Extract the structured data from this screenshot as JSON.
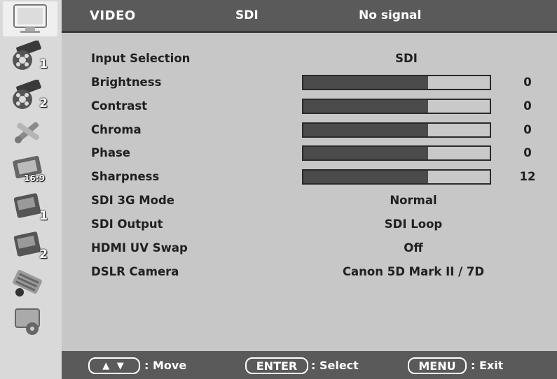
{
  "header": {
    "menu": "VIDEO",
    "source": "SDI",
    "signal": "No signal"
  },
  "sidebar": {
    "items": [
      {
        "icon": "monitor-icon",
        "badge": ""
      },
      {
        "icon": "film-reel-icon",
        "badge": "1"
      },
      {
        "icon": "film-reel-icon",
        "badge": "2"
      },
      {
        "icon": "tools-icon",
        "badge": ""
      },
      {
        "icon": "aspect-ratio-icon",
        "badge": "16:9"
      },
      {
        "icon": "abc-card-icon",
        "badge": "1"
      },
      {
        "icon": "abc-card-icon",
        "badge": "2"
      },
      {
        "icon": "keyboard-icon",
        "badge": ""
      },
      {
        "icon": "settings-screen-icon",
        "badge": ""
      }
    ]
  },
  "menu": {
    "input_selection": {
      "label": "Input Selection",
      "value": "SDI"
    },
    "brightness": {
      "label": "Brightness",
      "value": "0",
      "level": 0.67
    },
    "contrast": {
      "label": "Contrast",
      "value": "0",
      "level": 0.67
    },
    "chroma": {
      "label": "Chroma",
      "value": "0",
      "level": 0.67
    },
    "phase": {
      "label": "Phase",
      "value": "0",
      "level": 0.67
    },
    "sharpness": {
      "label": "Sharpness",
      "value": "12",
      "level": 0.67
    },
    "sdi_3g_mode": {
      "label": "SDI 3G Mode",
      "value": "Normal"
    },
    "sdi_output": {
      "label": "SDI Output",
      "value": "SDI Loop"
    },
    "hdmi_uv_swap": {
      "label": "HDMI UV Swap",
      "value": "Off"
    },
    "dslr_camera": {
      "label": "DSLR Camera",
      "value": "Canon 5D Mark II / 7D"
    }
  },
  "footer": {
    "move_key": "▲ ▼",
    "move_label": ": Move",
    "enter_key": "ENTER",
    "enter_label": ": Select",
    "menu_key": "MENU",
    "menu_label": ": Exit"
  },
  "colors": {
    "title_bar": "#5a5a5a",
    "panel": "#c7c7c7",
    "bar_fill": "#4b4b4b",
    "sidebar": "#d9d9d9"
  }
}
